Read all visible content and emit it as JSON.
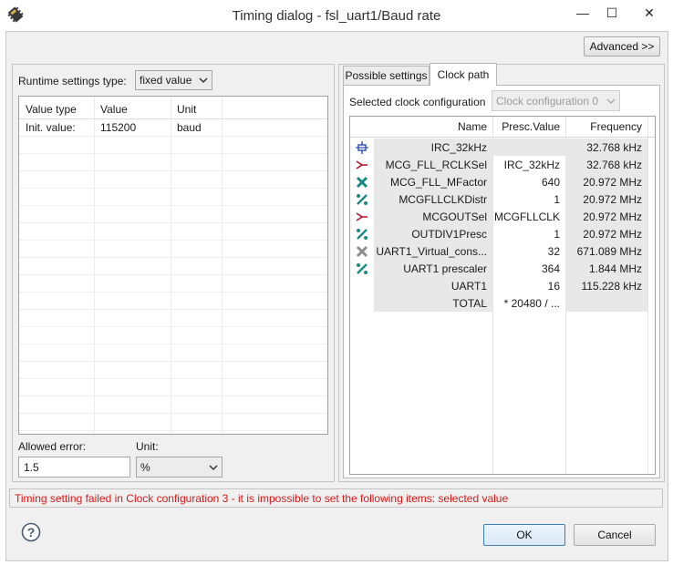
{
  "window": {
    "title": "Timing dialog - fsl_uart1/Baud rate",
    "minimize_glyph": "—",
    "maximize_glyph": "☐",
    "close_glyph": "✕"
  },
  "colors": {
    "accent": "#3c7fb1",
    "error_text": "#d81818",
    "shaded_cell": "#e8e8e8"
  },
  "advanced_button": "Advanced >>",
  "runtime": {
    "label": "Runtime settings type:",
    "selected": "fixed value"
  },
  "value_table": {
    "headers": [
      "Value type",
      "Value",
      "Unit"
    ],
    "rows": [
      {
        "type": "Init. value:",
        "value": "115200",
        "unit": "baud"
      }
    ]
  },
  "allowed_error": {
    "label": "Allowed error:",
    "value": "1.5"
  },
  "unit": {
    "label": "Unit:",
    "selected": "%"
  },
  "tabs": [
    {
      "label": "Possible settings",
      "active": false
    },
    {
      "label": "Clock path",
      "active": true
    }
  ],
  "clock_config": {
    "label": "Selected clock configuration",
    "selected": "Clock configuration 0"
  },
  "clock_table": {
    "headers": [
      "Name",
      "Presc.Value",
      "Frequency"
    ],
    "rows": [
      {
        "icon": "oscillator-icon",
        "name": "IRC_32kHz",
        "presc": "",
        "freq": "32.768 kHz",
        "presc_shaded": true
      },
      {
        "icon": "mux-icon",
        "name": "MCG_FLL_RCLKSel",
        "presc": "IRC_32kHz",
        "freq": "32.768 kHz",
        "presc_shaded": false
      },
      {
        "icon": "multiplier-icon",
        "name": "MCG_FLL_MFactor",
        "presc": "640",
        "freq": "20.972 MHz",
        "presc_shaded": false
      },
      {
        "icon": "divider-icon",
        "name": "MCGFLLCLKDistr",
        "presc": "1",
        "freq": "20.972 MHz",
        "presc_shaded": false
      },
      {
        "icon": "mux-icon",
        "name": "MCGOUTSel",
        "presc": "MCGFLLCLK",
        "freq": "20.972 MHz",
        "presc_shaded": false
      },
      {
        "icon": "divider-icon",
        "name": "OUTDIV1Presc",
        "presc": "1",
        "freq": "20.972 MHz",
        "presc_shaded": false
      },
      {
        "icon": "virtual-multiplier-icon",
        "name": "UART1_Virtual_cons...",
        "presc": "32",
        "freq": "671.089 MHz",
        "presc_shaded": false
      },
      {
        "icon": "divider-icon",
        "name": "UART1 prescaler",
        "presc": "364",
        "freq": "1.844 MHz",
        "presc_shaded": false
      },
      {
        "icon": "",
        "name": "UART1",
        "presc": "16",
        "freq": "115.228 kHz",
        "presc_shaded": false
      },
      {
        "icon": "",
        "name": "TOTAL",
        "presc": "* 20480 / ...",
        "freq": "",
        "presc_shaded": false
      }
    ]
  },
  "status": {
    "message": "Timing setting failed in Clock configuration 3 - it is impossible to set the following items: selected value"
  },
  "buttons": {
    "ok": "OK",
    "cancel": "Cancel",
    "help_glyph": "?"
  }
}
